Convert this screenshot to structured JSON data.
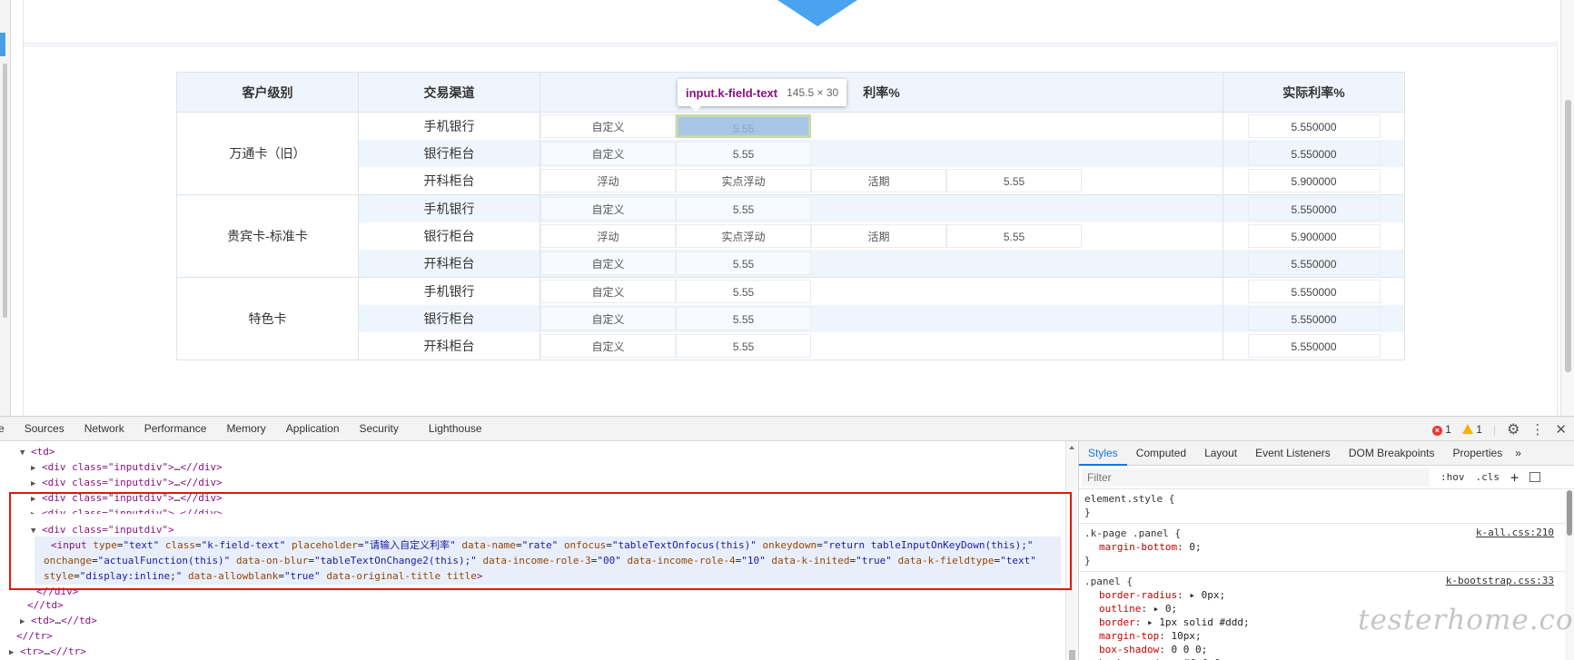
{
  "table": {
    "headers": [
      "客户级别",
      "交易渠道",
      "利率%",
      "实际利率%"
    ],
    "groups": [
      {
        "name": "万通卡（旧）",
        "rows": [
          {
            "channel": "手机银行",
            "cells": [
              "自定义",
              "5.55",
              "",
              ""
            ],
            "actual": "5.550000"
          },
          {
            "channel": "银行柜台",
            "cells": [
              "自定义",
              "5.55",
              "",
              ""
            ],
            "actual": "5.550000"
          },
          {
            "channel": "开科柜台",
            "cells": [
              "浮动",
              "实点浮动",
              "活期",
              "5.55"
            ],
            "actual": "5.900000"
          }
        ]
      },
      {
        "name": "贵宾卡-标准卡",
        "rows": [
          {
            "channel": "手机银行",
            "cells": [
              "自定义",
              "5.55",
              "",
              ""
            ],
            "actual": "5.550000"
          },
          {
            "channel": "银行柜台",
            "cells": [
              "浮动",
              "实点浮动",
              "活期",
              "5.55"
            ],
            "actual": "5.900000"
          },
          {
            "channel": "开科柜台",
            "cells": [
              "自定义",
              "5.55",
              "",
              ""
            ],
            "actual": "5.550000"
          }
        ]
      },
      {
        "name": "特色卡",
        "rows": [
          {
            "channel": "手机银行",
            "cells": [
              "自定义",
              "5.55",
              "",
              ""
            ],
            "actual": "5.550000"
          },
          {
            "channel": "银行柜台",
            "cells": [
              "自定义",
              "5.55",
              "",
              ""
            ],
            "actual": "5.550000"
          },
          {
            "channel": "开科柜台",
            "cells": [
              "自定义",
              "5.55",
              "",
              ""
            ],
            "actual": "5.550000"
          }
        ]
      }
    ]
  },
  "tooltip": {
    "selector": "input.k-field-text",
    "size": "145.5 × 30"
  },
  "devtools": {
    "tabs": [
      "e",
      "Sources",
      "Network",
      "Performance",
      "Memory",
      "Application",
      "Security",
      "Lighthouse"
    ],
    "error_count": "1",
    "warning_count": "1",
    "dom_lines": {
      "td_open": "td",
      "inputdiv": "div class=\"inputdiv\"",
      "collapsed_ellipsis": "…",
      "div_close": "/div",
      "input_tag": "input",
      "attrs": [
        {
          "n": "type",
          "v": "\"text\""
        },
        {
          "n": "class",
          "v": "\"k-field-text\""
        },
        {
          "n": "placeholder",
          "v": "\"请输入自定义利率\""
        },
        {
          "n": "data-name",
          "v": "\"rate\""
        },
        {
          "n": "onfocus",
          "v": "\"tableTextOnfocus(this)\""
        },
        {
          "n": "onkeydown",
          "v": "\"return tableInputOnKeyDown(this);\""
        }
      ],
      "attrs2": [
        {
          "n": "onchange",
          "v": "\"actualFunction(this)\""
        },
        {
          "n": "data-on-blur",
          "v": "\"tableTextOnChange2(this);\""
        },
        {
          "n": "data-income-role-3",
          "v": "\"00\""
        },
        {
          "n": "data-income-role-4",
          "v": "\"10\""
        },
        {
          "n": "data-k-inited",
          "v": "\"true\""
        },
        {
          "n": "data-k-fieldtype",
          "v": "\"text\""
        }
      ],
      "attrs3": [
        {
          "n": "style",
          "v": "\"display:inline;\""
        },
        {
          "n": "data-allowblank",
          "v": "\"true\""
        },
        {
          "n": "data-original-title",
          "v": ""
        },
        {
          "n": "title",
          "v": ""
        }
      ],
      "td_close": "/td",
      "td_collapsed": "td",
      "tr_close": "/tr",
      "tr_collapsed": "tr"
    },
    "styles_tabs": [
      "Styles",
      "Computed",
      "Layout",
      "Event Listeners",
      "DOM Breakpoints",
      "Properties"
    ],
    "filter_placeholder": "Filter",
    "hov": ":hov",
    "cls": ".cls",
    "rules": {
      "element_style": "element.style {",
      "close": "}",
      "r1_selector": ".k-page .panel {",
      "r1_source": "k-all.css:210",
      "r1_props": [
        {
          "n": "margin-bottom",
          "v": "0;"
        }
      ],
      "r2_selector": ".panel {",
      "r2_source": "k-bootstrap.css:33",
      "r2_props": [
        {
          "n": "border-radius",
          "v": "▸ 0px;"
        },
        {
          "n": "outline",
          "v": "▸ 0;"
        },
        {
          "n": "border",
          "v": "▸ 1px solid  #ddd;"
        },
        {
          "n": "margin-top",
          "v": "10px;"
        },
        {
          "n": "box-shadow",
          "v": "  0 0 0;"
        },
        {
          "n": "background",
          "v": "▸   #fafafa;"
        }
      ]
    }
  },
  "watermark": "testerhome.com",
  "colors": {
    "accent_blue": "#4aa3ee",
    "highlight_input": "#a7c6e6",
    "selection_border": "#e3170a",
    "header_bg": "#eef5fc"
  }
}
